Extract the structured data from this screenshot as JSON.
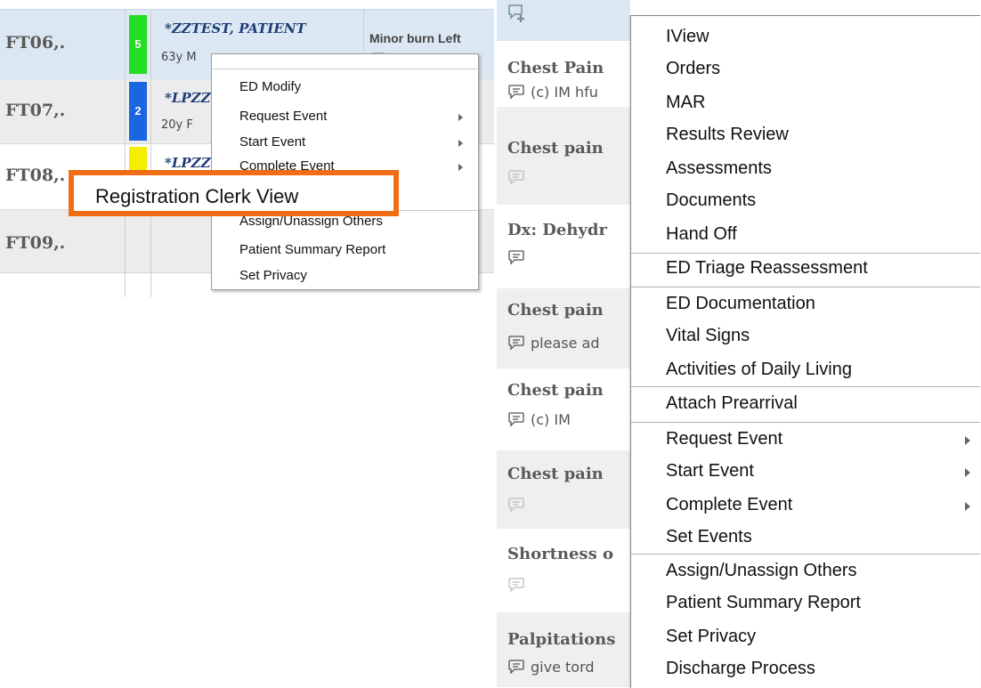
{
  "board": {
    "rows": [
      {
        "room": "FT06,.",
        "acuity": "5",
        "acuity_color": "#22dd22",
        "patient": "*ZZTEST, PATIENT",
        "demo": "63y M",
        "complaint": "Minor burn Left"
      },
      {
        "room": "FT07,.",
        "acuity": "2",
        "acuity_color": "#1a66e0",
        "patient": "*LPZZ",
        "demo": "20y F"
      },
      {
        "room": "FT08,.",
        "acuity": "",
        "acuity_color": "#f4ee00",
        "patient": "*LPZZ"
      },
      {
        "room": "FT09,."
      }
    ]
  },
  "small_menu": {
    "items": [
      "ED Modify",
      "Request Event",
      "Start Event",
      "Complete Event",
      "Assign/Unassign Others",
      "Patient Summary Report",
      "Set Privacy"
    ]
  },
  "callout": {
    "label": "Registration Clerk View",
    "color": "#f26d13"
  },
  "middle_column": {
    "cells": [
      {
        "title": "Chest Pain",
        "comment": "(c) IM hfu"
      },
      {
        "title": "Chest pain",
        "comment": ""
      },
      {
        "title": "Dx: Dehydr",
        "comment": ""
      },
      {
        "title": "Chest pain",
        "comment": "please ad"
      },
      {
        "title": "Chest pain",
        "comment": "(c) IM"
      },
      {
        "title": "Chest pain",
        "comment": ""
      },
      {
        "title": "Shortness o",
        "comment": ""
      },
      {
        "title": "Palpitations",
        "comment": "give tord"
      }
    ]
  },
  "big_menu": {
    "items": [
      "IView",
      "Orders",
      "MAR",
      "Results Review",
      "Assessments",
      "Documents",
      "Hand Off",
      "ED Triage Reassessment",
      "ED Documentation",
      "Vital Signs",
      "Activities of Daily Living",
      "Attach Prearrival",
      "Request Event",
      "Start Event",
      "Complete Event",
      "Set Events",
      "Assign/Unassign Others",
      "Patient Summary Report",
      "Set Privacy",
      "Discharge Process"
    ]
  }
}
